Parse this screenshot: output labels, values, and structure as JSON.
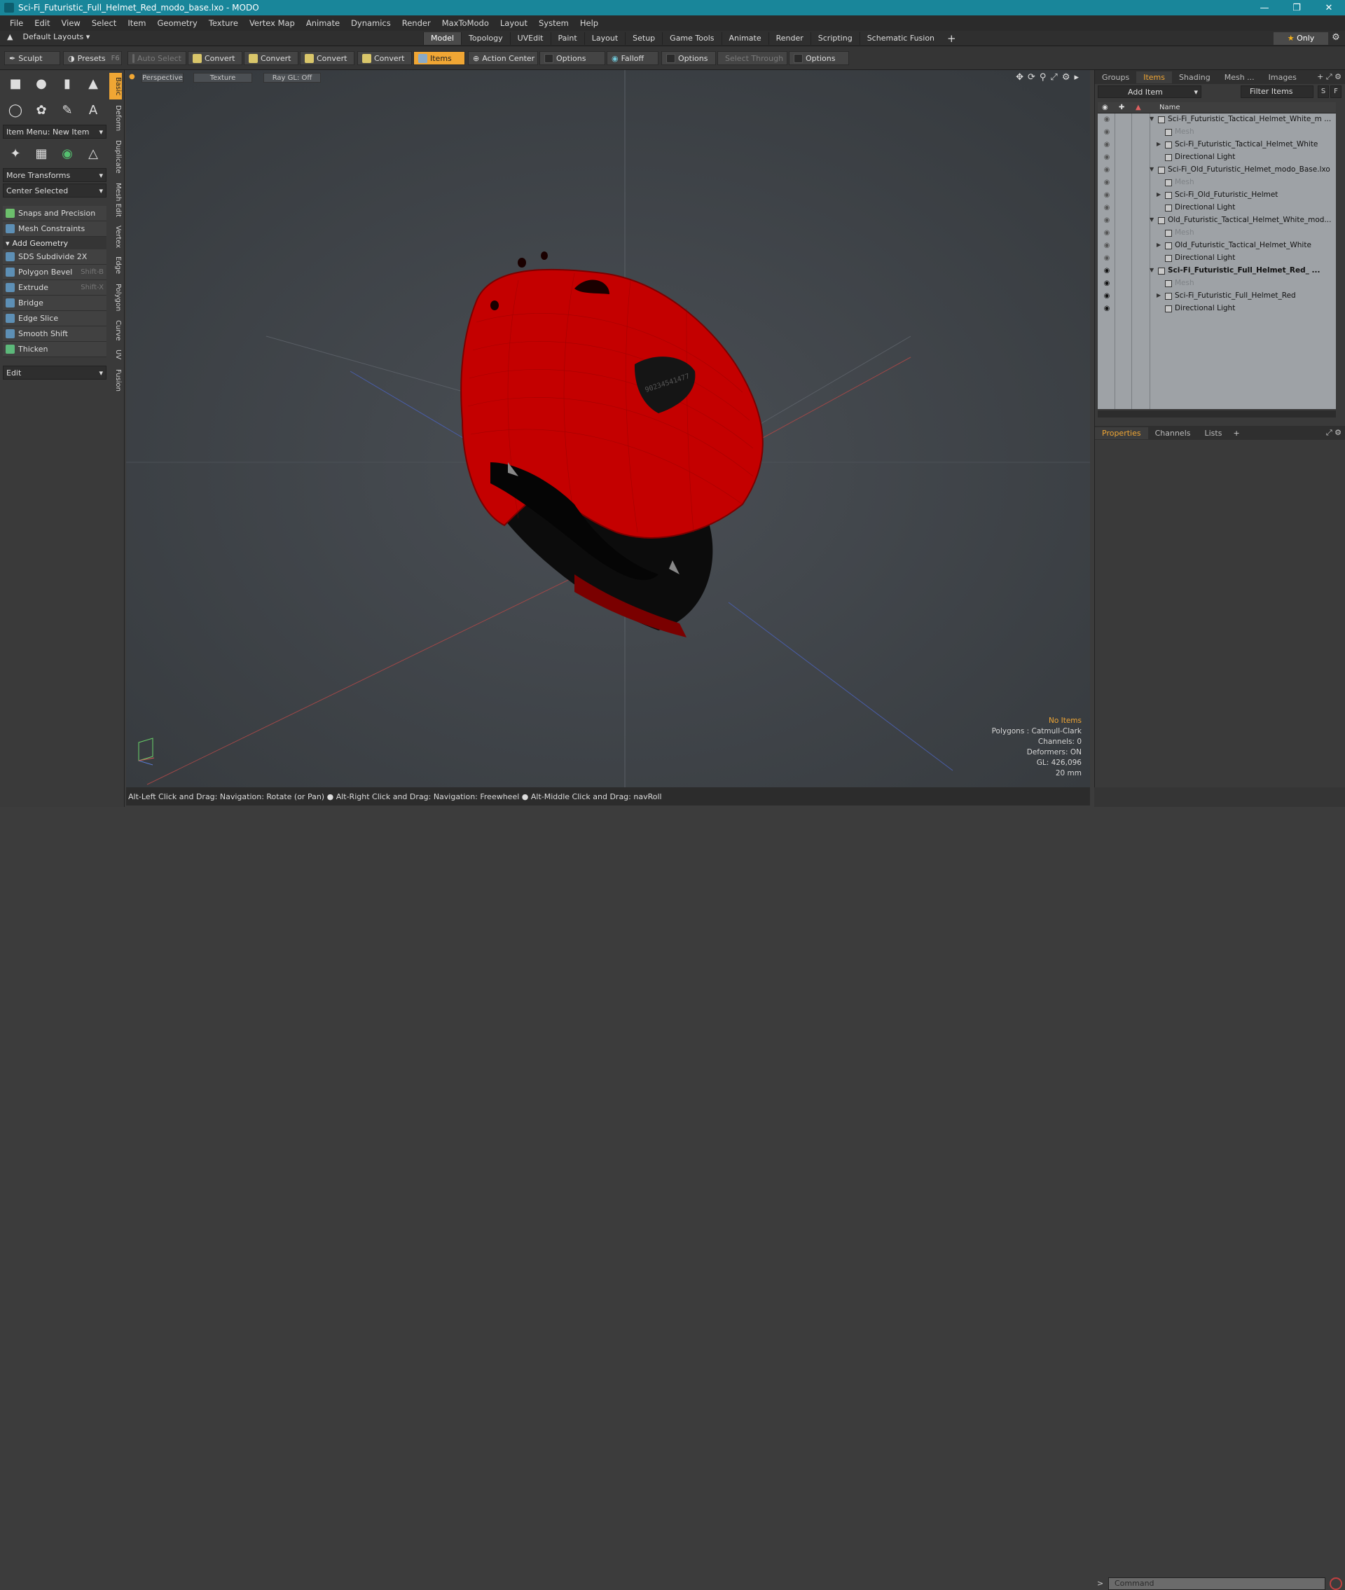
{
  "window": {
    "title": "Sci-Fi_Futuristic_Full_Helmet_Red_modo_base.lxo - MODO"
  },
  "menu": [
    "File",
    "Edit",
    "View",
    "Select",
    "Item",
    "Geometry",
    "Texture",
    "Vertex Map",
    "Animate",
    "Dynamics",
    "Render",
    "MaxToModo",
    "Layout",
    "System",
    "Help"
  ],
  "layouts": {
    "label": "Default Layouts"
  },
  "mode_tabs": [
    "Model",
    "Topology",
    "UVEdit",
    "Paint",
    "Layout",
    "Setup",
    "Game Tools",
    "Animate",
    "Render",
    "Scripting",
    "Schematic Fusion"
  ],
  "only_label": "Only",
  "toolbar": {
    "sculpt": "Sculpt",
    "presets": "Presets",
    "presets_shortcut": "F6",
    "auto_select": "Auto Select",
    "convert1": "Convert",
    "convert2": "Convert",
    "convert3": "Convert",
    "convert4": "Convert",
    "items": "Items",
    "action_center": "Action Center",
    "options1": "Options",
    "falloff": "Falloff",
    "options2": "Options",
    "select_through": "Select Through",
    "options3": "Options"
  },
  "left": {
    "item_menu": "Item Menu: New Item",
    "more_transforms": "More Transforms",
    "center_selected": "Center Selected",
    "snaps": "Snaps and Precision",
    "constraints": "Mesh Constraints",
    "add_geometry": "Add Geometry",
    "tools": [
      {
        "label": "SDS Subdivide 2X",
        "shortcut": ""
      },
      {
        "label": "Polygon Bevel",
        "shortcut": "Shift-B"
      },
      {
        "label": "Extrude",
        "shortcut": "Shift-X"
      },
      {
        "label": "Bridge",
        "shortcut": ""
      },
      {
        "label": "Edge Slice",
        "shortcut": ""
      },
      {
        "label": "Smooth Shift",
        "shortcut": ""
      },
      {
        "label": "Thicken",
        "shortcut": ""
      }
    ],
    "edit": "Edit",
    "vtabs": [
      "Basic",
      "Deform",
      "Duplicate",
      "Mesh Edit",
      "Vertex",
      "Edge",
      "Polygon",
      "Curve",
      "UV",
      "Fusion"
    ]
  },
  "viewport": {
    "perspective": "Perspective",
    "texture": "Texture",
    "raygl": "Ray GL: Off",
    "helmet_text": "90234541477",
    "stats": {
      "no_items": "No Items",
      "polygons": "Polygons : Catmull-Clark",
      "channels": "Channels: 0",
      "deformers": "Deformers: ON",
      "gl": "GL: 426,096",
      "scale": "20 mm"
    }
  },
  "status": "Alt-Left Click and Drag: Navigation: Rotate (or Pan) ● Alt-Right Click and Drag: Navigation: Freewheel ● Alt-Middle Click and Drag: navRoll",
  "right": {
    "tabs": [
      "Groups",
      "Items",
      "Shading",
      "Mesh ...",
      "Images"
    ],
    "add_item": "Add Item",
    "filter": "Filter Items",
    "s": "S",
    "f": "F",
    "name_col": "Name",
    "tree": [
      {
        "label": "Sci-Fi_Futuristic_Tactical_Helmet_White_m ...",
        "level": 0,
        "eye": false,
        "dim": false,
        "bold": false
      },
      {
        "label": "Mesh",
        "level": 1,
        "eye": false,
        "dim": true,
        "bold": false
      },
      {
        "label": "Sci-Fi_Futuristic_Tactical_Helmet_White",
        "level": 1,
        "eye": false,
        "dim": false,
        "bold": false
      },
      {
        "label": "Directional Light",
        "level": 1,
        "eye": false,
        "dim": false,
        "bold": false
      },
      {
        "label": "Sci-Fi_Old_Futuristic_Helmet_modo_Base.lxo",
        "level": 0,
        "eye": false,
        "dim": false,
        "bold": false
      },
      {
        "label": "Mesh",
        "level": 1,
        "eye": false,
        "dim": true,
        "bold": false
      },
      {
        "label": "Sci-Fi_Old_Futuristic_Helmet",
        "level": 1,
        "eye": false,
        "dim": false,
        "bold": false
      },
      {
        "label": "Directional Light",
        "level": 1,
        "eye": false,
        "dim": false,
        "bold": false
      },
      {
        "label": "Old_Futuristic_Tactical_Helmet_White_mod...",
        "level": 0,
        "eye": false,
        "dim": false,
        "bold": false
      },
      {
        "label": "Mesh",
        "level": 1,
        "eye": false,
        "dim": true,
        "bold": false
      },
      {
        "label": "Old_Futuristic_Tactical_Helmet_White",
        "level": 1,
        "eye": false,
        "dim": false,
        "bold": false
      },
      {
        "label": "Directional Light",
        "level": 1,
        "eye": false,
        "dim": false,
        "bold": false
      },
      {
        "label": "Sci-Fi_Futuristic_Full_Helmet_Red_ ...",
        "level": 0,
        "eye": true,
        "dim": false,
        "bold": true
      },
      {
        "label": "Mesh",
        "level": 1,
        "eye": true,
        "dim": true,
        "bold": false
      },
      {
        "label": "Sci-Fi_Futuristic_Full_Helmet_Red",
        "level": 1,
        "eye": true,
        "dim": false,
        "bold": false
      },
      {
        "label": "Directional Light",
        "level": 1,
        "eye": true,
        "dim": false,
        "bold": false
      }
    ],
    "prop_tabs": [
      "Properties",
      "Channels",
      "Lists"
    ],
    "command_placeholder": "Command"
  },
  "colors": {
    "accent": "#f0a634",
    "titlebar": "#19869a",
    "helmet": "#c40000"
  }
}
